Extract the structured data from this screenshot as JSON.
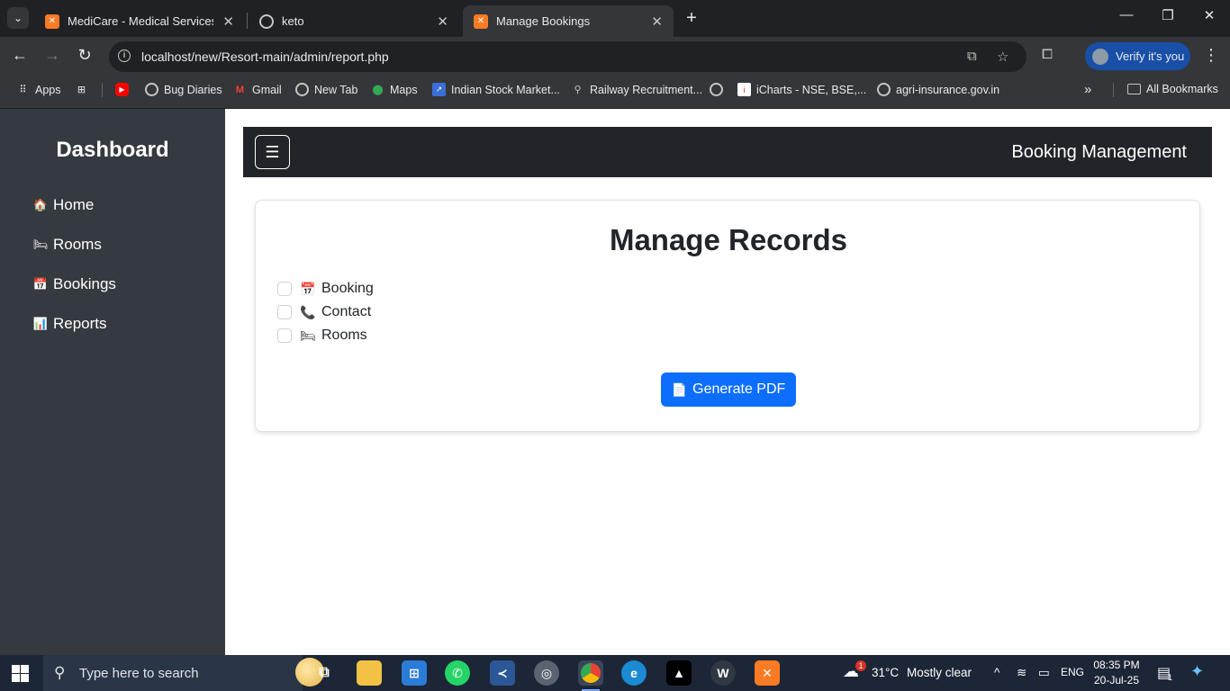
{
  "browser": {
    "tabs": [
      {
        "title": "MediCare - Medical Services",
        "favicon": "xampp-icon"
      },
      {
        "title": "keto",
        "favicon": "globe-icon"
      },
      {
        "title": "Manage Bookings",
        "favicon": "xampp-icon",
        "active": true
      }
    ],
    "url": "localhost/new/Resort-main/admin/report.php",
    "verify_label": "Verify it's you",
    "bookmarks": [
      {
        "label": "Apps",
        "icon": "apps-grid-icon"
      },
      {
        "label": "",
        "icon": "tab-groups-icon"
      },
      {
        "label": "",
        "icon": "youtube-icon"
      },
      {
        "label": "Bug Diaries",
        "icon": "globe-icon"
      },
      {
        "label": "Gmail",
        "icon": "gmail-icon"
      },
      {
        "label": "New Tab",
        "icon": "globe-icon"
      },
      {
        "label": "Maps",
        "icon": "maps-icon"
      },
      {
        "label": "Indian Stock Market...",
        "icon": "stock-icon"
      },
      {
        "label": "Railway Recruitment...",
        "icon": "railway-icon"
      },
      {
        "label": "",
        "icon": "globe-icon"
      },
      {
        "label": "iCharts - NSE, BSE,...",
        "icon": "icharts-icon"
      },
      {
        "label": "agri-insurance.gov.in",
        "icon": "globe-icon"
      }
    ],
    "all_bookmarks_label": "All Bookmarks"
  },
  "sidebar": {
    "title": "Dashboard",
    "items": [
      {
        "label": "Home",
        "icon": "house-icon"
      },
      {
        "label": "Rooms",
        "icon": "bed-icon"
      },
      {
        "label": "Bookings",
        "icon": "calendar-icon"
      },
      {
        "label": "Reports",
        "icon": "bar-chart-icon"
      }
    ]
  },
  "navbar": {
    "toggle_glyph": "☰",
    "brand": "Booking Management"
  },
  "card": {
    "title": "Manage Records",
    "options": [
      {
        "label": "Booking",
        "icon": "calendar-icon",
        "checked": false
      },
      {
        "label": "Contact",
        "icon": "telephone-icon",
        "checked": false
      },
      {
        "label": "Rooms",
        "icon": "bed-icon",
        "checked": false
      }
    ],
    "button_label": "Generate PDF",
    "button_color": "#0d6efd"
  },
  "taskbar": {
    "search_placeholder": "Type here to search",
    "weather_temp": "31°C",
    "weather_desc": "Mostly clear",
    "language": "ENG",
    "time": "08:35 PM",
    "date": "20-Jul-25",
    "notification_count": "1",
    "weather_badge": "1"
  },
  "colors": {
    "sidebar_bg": "#343a40",
    "navbar_bg": "#212529",
    "primary": "#0d6efd"
  }
}
